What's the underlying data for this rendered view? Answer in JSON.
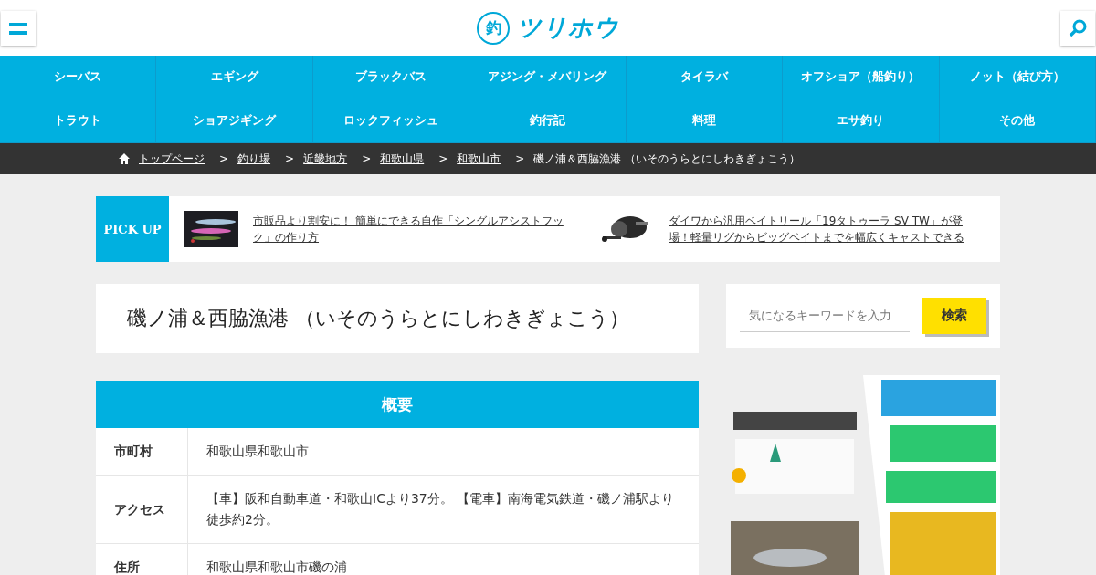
{
  "header": {
    "logo_mark": "釣",
    "logo_text": "ツリホウ"
  },
  "nav": [
    {
      "label": "シーバス"
    },
    {
      "label": "エギング"
    },
    {
      "label": "ブラックバス"
    },
    {
      "label": "アジング・メバリング"
    },
    {
      "label": "タイラバ"
    },
    {
      "label": "オフショア（船釣り）"
    },
    {
      "label": "ノット（結び方）"
    },
    {
      "label": "トラウト"
    },
    {
      "label": "ショアジギング"
    },
    {
      "label": "ロックフィッシュ"
    },
    {
      "label": "釣行記"
    },
    {
      "label": "料理"
    },
    {
      "label": "エサ釣り"
    },
    {
      "label": "その他"
    }
  ],
  "breadcrumb": [
    {
      "label": "トップページ",
      "link": true
    },
    {
      "sep": ">",
      "label": "釣り場",
      "link": true
    },
    {
      "sep": ">",
      "label": "近畿地方",
      "link": true
    },
    {
      "sep": ">",
      "label": "和歌山県",
      "link": true
    },
    {
      "sep": ">",
      "label": "和歌山市",
      "link": true
    },
    {
      "sep": ">",
      "label": "磯ノ浦＆西脇漁港 （いそのうらとにしわきぎょこう）",
      "link": false
    }
  ],
  "pickup": {
    "label": "PICK UP",
    "items": [
      {
        "kind": "picture",
        "title": "市販品より割安に！ 簡単にできる自作「シングルアシストフック」の作り方"
      },
      {
        "kind": "picture",
        "title": "ダイワから汎用ベイトリール「19タトゥーラ SV TW」が登場！軽量リグからビッグベイトまでを幅広くキャストできる"
      }
    ]
  },
  "page_title": "磯ノ浦＆西脇漁港 （いそのうらとにしわきぎょこう）",
  "overview": {
    "heading": "概要",
    "rows": [
      {
        "label": "市町村",
        "value": "和歌山県和歌山市"
      },
      {
        "label": "アクセス",
        "value": "【車】阪和自動車道・和歌山ICより37分。 【電車】南海電気鉄道・磯ノ浦駅より徒歩約2分。"
      },
      {
        "label": "住所",
        "value": "和歌山県和歌山市磯の浦"
      }
    ]
  },
  "search": {
    "placeholder": "気になるキーワードを入力",
    "button": "検索"
  }
}
